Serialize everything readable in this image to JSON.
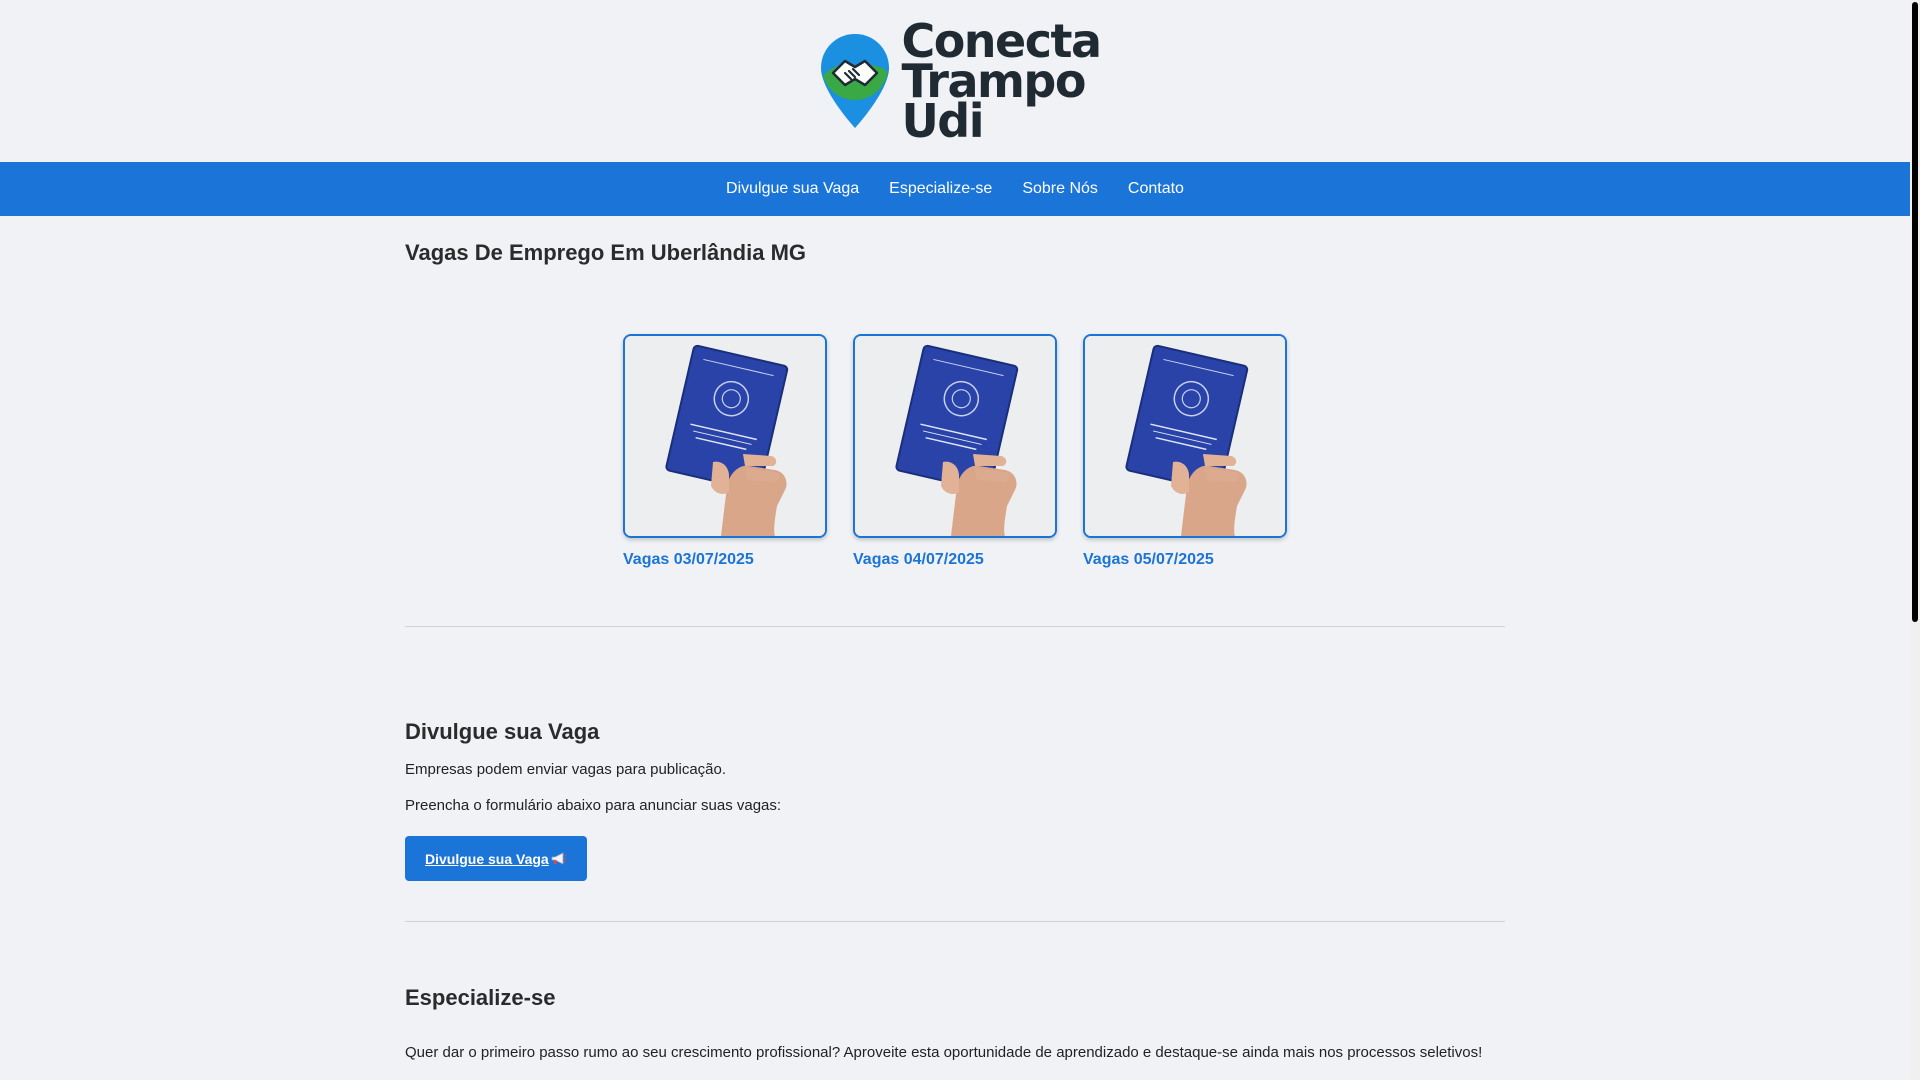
{
  "logo": {
    "line1": "Conecta",
    "line2": "Trampo",
    "line3": "Udi"
  },
  "nav": {
    "items": [
      {
        "label": "Divulgue sua Vaga"
      },
      {
        "label": "Especialize-se"
      },
      {
        "label": "Sobre Nós"
      },
      {
        "label": "Contato"
      }
    ]
  },
  "main": {
    "title": "Vagas De Emprego Em Uberlândia MG",
    "cards": [
      {
        "label": "Vagas 03/07/2025"
      },
      {
        "label": "Vagas 04/07/2025"
      },
      {
        "label": "Vagas 05/07/2025"
      }
    ]
  },
  "divulgue": {
    "title": "Divulgue sua Vaga",
    "p1": "Empresas podem enviar vagas para publicação.",
    "p2": "Preencha o formulário abaixo para anunciar suas vagas:",
    "button_label": "Divulgue sua Vaga"
  },
  "especialize": {
    "title": "Especialize-se",
    "p1": "Quer dar o primeiro passo rumo ao seu crescimento profissional? Aproveite esta oportunidade de aprendizado e destaque-se ainda mais nos processos seletivos!"
  },
  "colors": {
    "primary": "#1b74d8",
    "background": "#f0f2f5",
    "logo_green": "#3aa845",
    "logo_blue": "#1b8fe0"
  },
  "icons": {
    "logo": "map-pin-handshake-icon",
    "button": "megaphone-icon",
    "card_image": "work-card-in-hand-photo"
  }
}
